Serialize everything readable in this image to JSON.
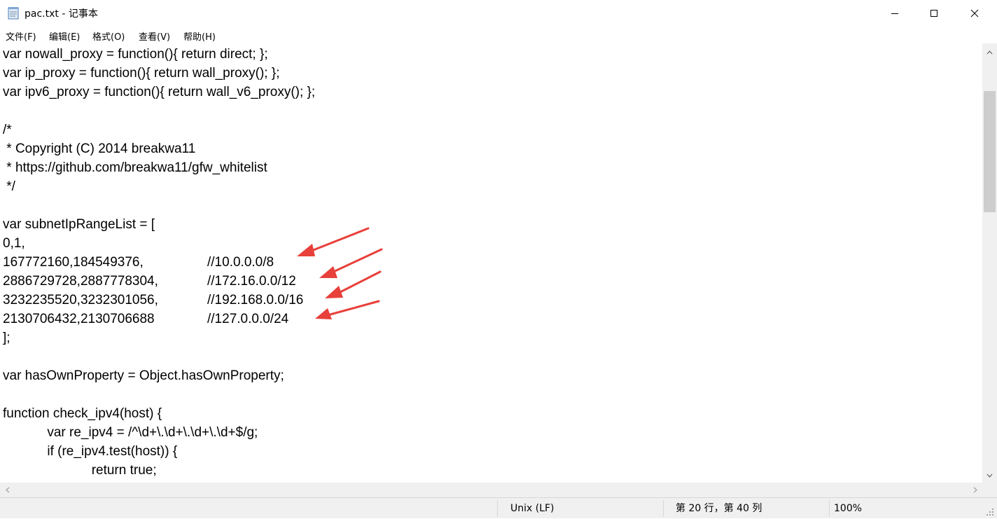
{
  "window": {
    "title": "pac.txt - 记事本",
    "icon": "notepad-icon",
    "controls": [
      "minimize-icon",
      "maximize-icon",
      "close-icon"
    ]
  },
  "menu": [
    "文件(F)",
    "编辑(E)",
    "格式(O)",
    "查看(V)",
    "帮助(H)"
  ],
  "editor": {
    "lines": [
      {
        "code": "var nowall_proxy = function(){ return direct; };",
        "comment": ""
      },
      {
        "code": "var ip_proxy = function(){ return wall_proxy(); };",
        "comment": ""
      },
      {
        "code": "var ipv6_proxy = function(){ return wall_v6_proxy(); };",
        "comment": ""
      },
      {
        "code": "",
        "comment": ""
      },
      {
        "code": "/*",
        "comment": ""
      },
      {
        "code": " * Copyright (C) 2014 breakwa11",
        "comment": ""
      },
      {
        "code": " * https://github.com/breakwa11/gfw_whitelist",
        "comment": ""
      },
      {
        "code": " */",
        "comment": ""
      },
      {
        "code": "",
        "comment": ""
      },
      {
        "code": "var subnetIpRangeList = [",
        "comment": ""
      },
      {
        "code": "0,1,",
        "comment": ""
      },
      {
        "code": "167772160,184549376,",
        "comment": "//10.0.0.0/8"
      },
      {
        "code": "2886729728,2887778304,",
        "comment": "//172.16.0.0/12"
      },
      {
        "code": "3232235520,3232301056,",
        "comment": "//192.168.0.0/16"
      },
      {
        "code": "2130706432,2130706688",
        "comment": "//127.0.0.0/24"
      },
      {
        "code": "];",
        "comment": ""
      },
      {
        "code": "",
        "comment": ""
      },
      {
        "code": "var hasOwnProperty = Object.hasOwnProperty;",
        "comment": ""
      },
      {
        "code": "",
        "comment": ""
      },
      {
        "code": "function check_ipv4(host) {",
        "comment": ""
      },
      {
        "code": "            var re_ipv4 = /^\\d+\\.\\d+\\.\\d+\\.\\d+$/g;",
        "comment": ""
      },
      {
        "code": "            if (re_ipv4.test(host)) {",
        "comment": ""
      },
      {
        "code": "                        return true;",
        "comment": ""
      }
    ]
  },
  "annotation": {
    "color": "#e8403a",
    "arrow_count": 4
  },
  "statusbar": {
    "line_ending": "Unix (LF)",
    "position": "第 20 行，第 40 列",
    "zoom": "100%"
  }
}
